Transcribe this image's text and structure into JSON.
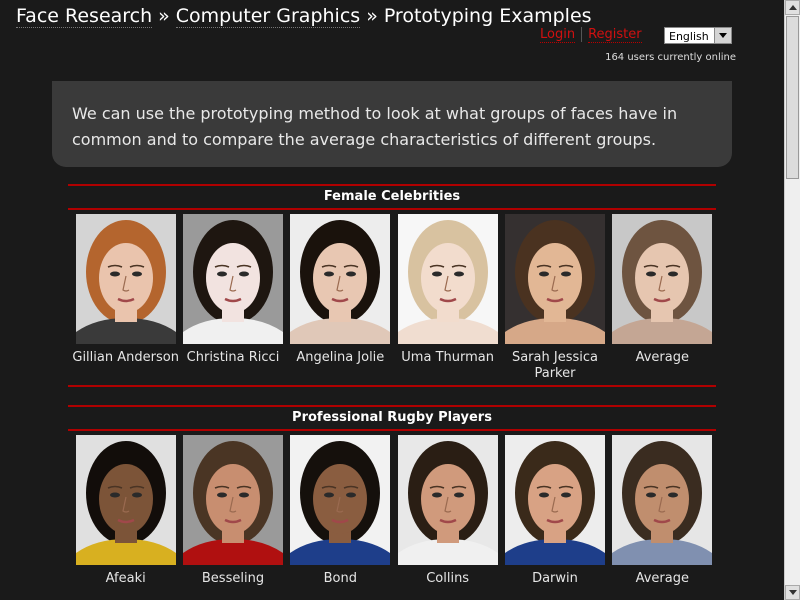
{
  "breadcrumb": {
    "items": [
      "Face Research",
      "Computer Graphics",
      "Prototyping Examples"
    ],
    "separator": "»"
  },
  "user_links": {
    "login": "Login",
    "register": "Register"
  },
  "language": {
    "selected": "English"
  },
  "online_status": "164 users currently online",
  "intro_text": "We can use the prototyping method to look at what groups of faces have in common and to compare the average characteristics of different groups.",
  "sections": [
    {
      "title": "Female Celebrities",
      "people": [
        {
          "name": "Gillian Anderson",
          "hair": "#b4652e",
          "skin": "#eac4ad",
          "bg": "#d4d4d4",
          "shirt": "#3a3a3a"
        },
        {
          "name": "Christina Ricci",
          "hair": "#1e1610",
          "skin": "#f2e3e0",
          "bg": "#9a9a9a",
          "shirt": "#f0f0f0"
        },
        {
          "name": "Angelina Jolie",
          "hair": "#1a120c",
          "skin": "#e8c7b2",
          "bg": "#ededed",
          "shirt": "#e0c8b8"
        },
        {
          "name": "Uma Thurman",
          "hair": "#d8c2a0",
          "skin": "#f2dccd",
          "bg": "#f7f7f7",
          "shirt": "#f0ddd0"
        },
        {
          "name": "Sarah Jessica Parker",
          "hair": "#4a3220",
          "skin": "#e2b795",
          "bg": "#353030",
          "shirt": "#d6a888"
        },
        {
          "name": "Average",
          "hair": "#6e5440",
          "skin": "#e6c6b0",
          "bg": "#c8c8c8",
          "shirt": "#c4a694"
        }
      ]
    },
    {
      "title": "Professional Rugby Players",
      "people": [
        {
          "name": "Afeaki",
          "hair": "#120d0a",
          "skin": "#7c5438",
          "bg": "#e0e0e0",
          "shirt": "#d8b020"
        },
        {
          "name": "Besseling",
          "hair": "#4a3524",
          "skin": "#c88e70",
          "bg": "#9a9a9a",
          "shirt": "#b01010"
        },
        {
          "name": "Bond",
          "hair": "#15100c",
          "skin": "#8a5d40",
          "bg": "#f2f2f2",
          "shirt": "#1e3e8a"
        },
        {
          "name": "Collins",
          "hair": "#2a1e14",
          "skin": "#d09a7c",
          "bg": "#e8e8e8",
          "shirt": "#f0f0f0"
        },
        {
          "name": "Darwin",
          "hair": "#3a2a1a",
          "skin": "#d8a284",
          "bg": "#ededed",
          "shirt": "#1e3e8a"
        },
        {
          "name": "Average",
          "hair": "#3a2c20",
          "skin": "#c08e6e",
          "bg": "#e6e6e6",
          "shirt": "#8090b0"
        }
      ]
    }
  ]
}
